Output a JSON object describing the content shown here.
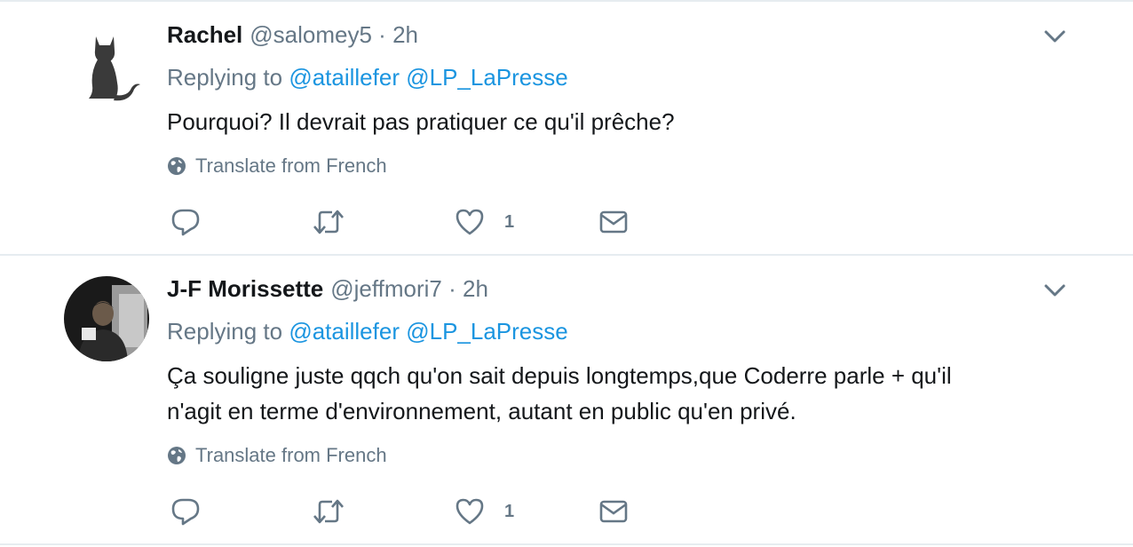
{
  "tweets": [
    {
      "name": "Rachel",
      "handle": "@salomey5",
      "separator": "·",
      "time": "2h",
      "replying_prefix": "Replying to",
      "mentions": [
        "@ataillefer",
        "@LP_LaPresse"
      ],
      "text_lines": [
        "Pourquoi? Il devrait pas pratiquer ce qu'il prêche?"
      ],
      "translate": "Translate from French",
      "like_count": "1",
      "avatar_icon": "cat-silhouette-icon"
    },
    {
      "name": "J-F Morissette",
      "handle": "@jeffmori7",
      "separator": "·",
      "time": "2h",
      "replying_prefix": "Replying to",
      "mentions": [
        "@ataillefer",
        "@LP_LaPresse"
      ],
      "text_lines": [
        "Ça souligne juste qqch qu'on sait depuis longtemps,que Coderre parle + qu'il",
        "n'agit en terme d'environnement, autant en public qu'en privé."
      ],
      "translate": "Translate from French",
      "like_count": "1",
      "avatar_icon": "person-photo-icon"
    }
  ],
  "colors": {
    "text": "#14171a",
    "secondary": "#657786",
    "link": "#1b95e0",
    "separator": "#e6ecf0"
  }
}
